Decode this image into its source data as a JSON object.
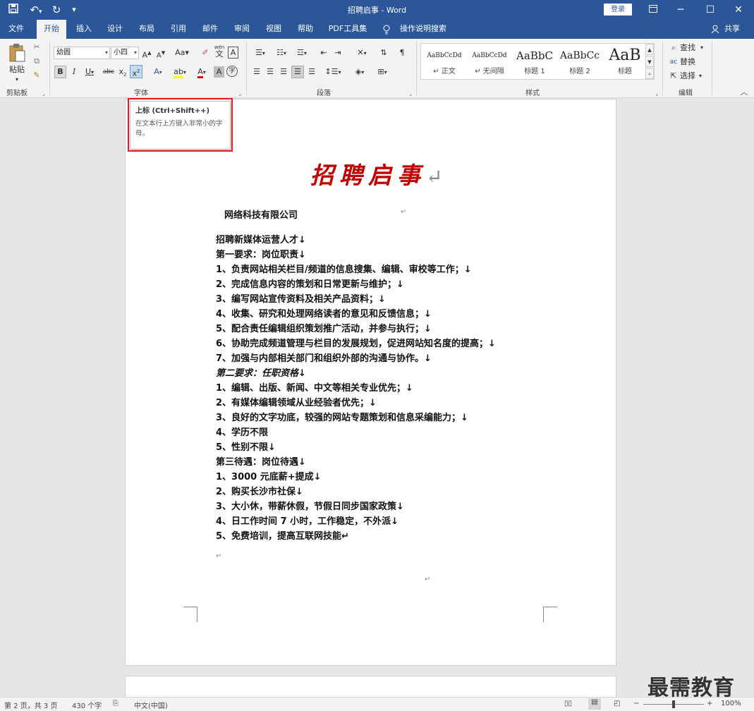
{
  "app": {
    "doc_title": "招聘启事  -  Word",
    "login": "登录",
    "share": "共享"
  },
  "menu": [
    "文件",
    "开始",
    "插入",
    "设计",
    "布局",
    "引用",
    "邮件",
    "审阅",
    "视图",
    "帮助",
    "PDF工具集",
    "操作说明搜索"
  ],
  "ribbon": {
    "clipboard": {
      "paste": "粘贴",
      "label": "剪贴板"
    },
    "font": {
      "name": "幼圆",
      "size": "小四",
      "label": "字体",
      "wen": "wén",
      "wen_char": "文",
      "case": "Aa",
      "abc": "abc"
    },
    "paragraph": {
      "label": "段落"
    },
    "styles": {
      "label": "样式",
      "items": [
        {
          "preview": "AaBbCcDd",
          "name": "↵ 正文"
        },
        {
          "preview": "AaBbCcDd",
          "name": "↵ 无间隔"
        },
        {
          "preview": "AaBbC",
          "name": "标题 1"
        },
        {
          "preview": "AaBbCc",
          "name": "标题 2"
        },
        {
          "preview": "AaB",
          "name": "标题"
        }
      ]
    },
    "editing": {
      "find": "查找",
      "replace": "替换",
      "select": "选择",
      "label": "编辑"
    }
  },
  "tooltip": {
    "title": "上标 (Ctrl+Shift++)",
    "desc": "在文本行上方键入非常小的字母。"
  },
  "document": {
    "heading": "招聘启事",
    "company": "网络科技有限公司",
    "lines": [
      {
        "text": "招聘新媒体运营人才↓"
      },
      {
        "text": "第一要求：岗位职责↓"
      },
      {
        "text": "1、负责网站相关栏目/频道的信息搜集、编辑、审校等工作；↓"
      },
      {
        "text": "2、完成信息内容的策划和日常更新与维护；↓"
      },
      {
        "text": "3、编写网站宣传资料及相关产品资料；↓"
      },
      {
        "text": "4、收集、研究和处理网络读者的意见和反馈信息；↓"
      },
      {
        "text": "5、配合责任编辑组织策划推广活动，并参与执行；↓"
      },
      {
        "text": "6、协助完成频道管理与栏目的发展规划，促进网站知名度的提高；↓"
      },
      {
        "text": "7、加强与内部相关部门和组织外部的沟通与协作。↓"
      },
      {
        "text": "第二要求：任职资格↓"
      },
      {
        "text": "1、编辑、出版、新闻、中文等相关专业优先；↓"
      },
      {
        "text": "2、有媒体编辑领域从业经验者优先；↓"
      },
      {
        "text": "3、良好的文字功底，较强的网站专题策划和信息采编能力；↓"
      },
      {
        "text": "4、学历不限"
      },
      {
        "text": "5、性别不限↓"
      },
      {
        "text": "第三待遇：岗位待遇↓"
      },
      {
        "text": "1、3000 元底薪+提成↓"
      },
      {
        "text": "2、购买长沙市社保↓"
      },
      {
        "text": "3、大小休，带薪休假，节假日同步国家政策↓"
      },
      {
        "text": "4、日工作时间 7 小时，工作稳定，不外派↓"
      },
      {
        "text": "5、免费培训，提高互联网技能↵"
      }
    ]
  },
  "status": {
    "page": "第 2 页，共 3 页",
    "words": "430 个字",
    "lang": "中文(中国)",
    "zoom": "100%"
  },
  "watermark": "最需教育"
}
